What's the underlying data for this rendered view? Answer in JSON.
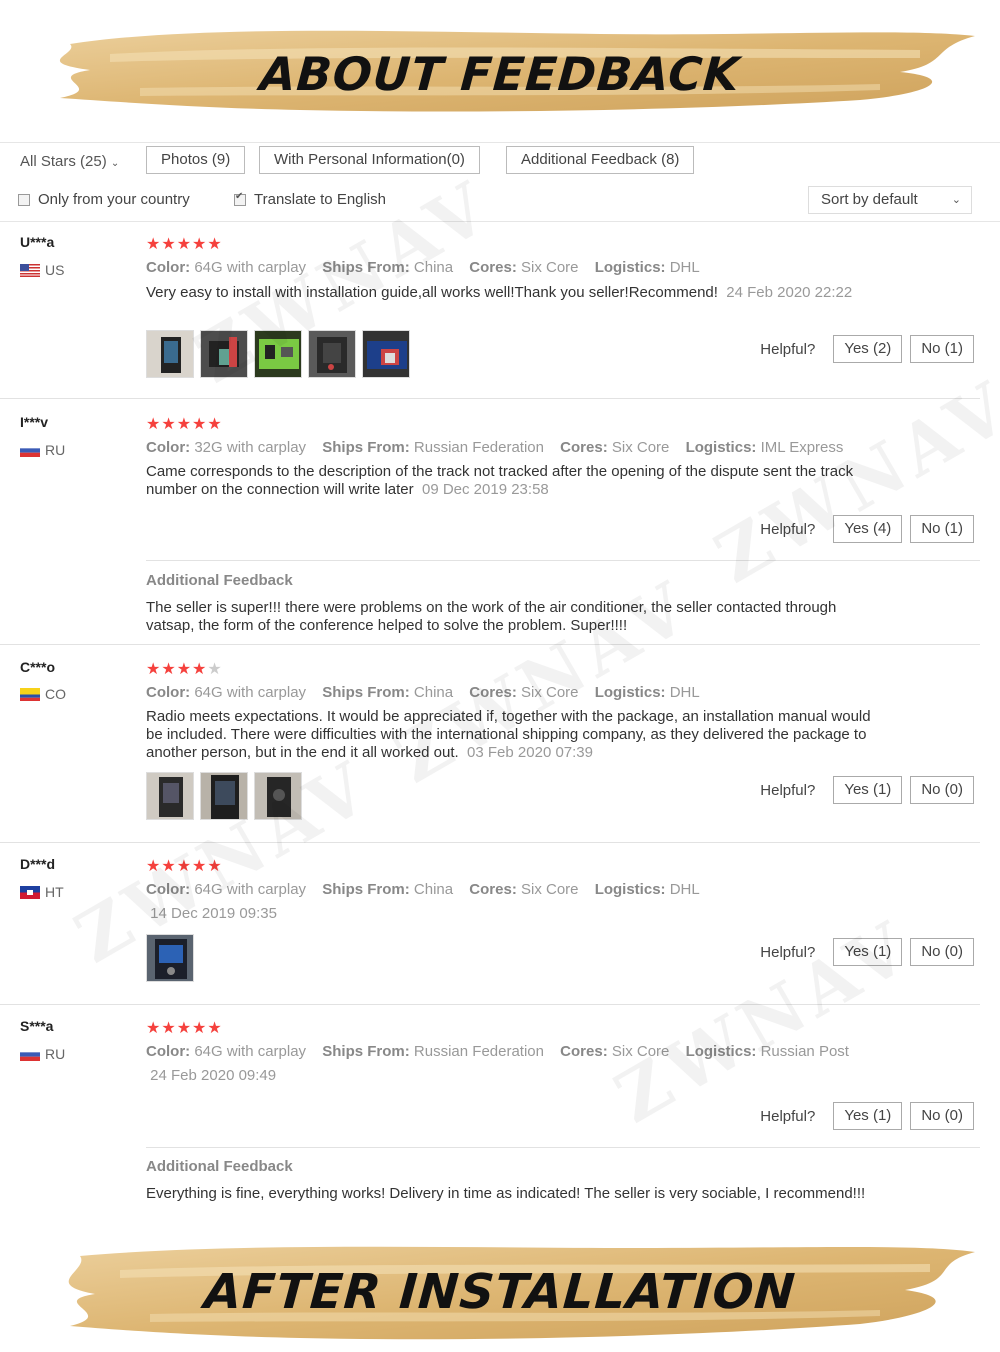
{
  "banners": {
    "top": "ABOUT FEEDBACK",
    "bottom": "AFTER INSTALLATION"
  },
  "watermark": "ZWNAV",
  "filters": {
    "all_stars": "All Stars (25)",
    "photos": "Photos (9)",
    "personal_info": "With Personal Information(0)",
    "additional": "Additional Feedback (8)",
    "only_country": "Only from your country",
    "only_country_checked": false,
    "translate": "Translate to English",
    "translate_checked": true,
    "sort": "Sort by default"
  },
  "labels": {
    "color": "Color:",
    "ships_from": "Ships From:",
    "cores": "Cores:",
    "logistics": "Logistics:",
    "helpful": "Helpful?",
    "additional_feedback": "Additional Feedback"
  },
  "reviews": [
    {
      "user": "U***a",
      "country": "US",
      "rating": 5,
      "color": "64G with carplay",
      "ships_from": "China",
      "cores": "Six Core",
      "logistics": "DHL",
      "text": "Very easy to install with installation guide,all works well!Thank you seller!Recommend!",
      "date": "24 Feb 2020 22:22",
      "photos": 5,
      "yes": "Yes (2)",
      "no": "No (1)"
    },
    {
      "user": "I***v",
      "country": "RU",
      "rating": 5,
      "color": "32G with carplay",
      "ships_from": "Russian Federation",
      "cores": "Six Core",
      "logistics": "IML Express",
      "text": "Came corresponds to the description of the track not tracked after the opening of the dispute sent the track number on the connection will write later",
      "date": "09 Dec 2019 23:58",
      "photos": 0,
      "yes": "Yes (4)",
      "no": "No (1)",
      "additional": "The seller is super!!! there were problems on the work of the air conditioner, the seller contacted through vatsap, the form of the conference helped to solve the problem. Super!!!!"
    },
    {
      "user": "C***o",
      "country": "CO",
      "rating": 4,
      "color": "64G with carplay",
      "ships_from": "China",
      "cores": "Six Core",
      "logistics": "DHL",
      "text": "Radio meets expectations. It would be appreciated if, together with the package, an installation manual would be included. There were difficulties with the international shipping company, as they delivered the package to another person, but in the end it all worked out.",
      "date": "03 Feb 2020 07:39",
      "photos": 3,
      "yes": "Yes (1)",
      "no": "No (0)"
    },
    {
      "user": "D***d",
      "country": "HT",
      "rating": 5,
      "color": "64G with carplay",
      "ships_from": "China",
      "cores": "Six Core",
      "logistics": "DHL",
      "text": "",
      "date": "14 Dec 2019 09:35",
      "photos": 1,
      "yes": "Yes (1)",
      "no": "No (0)"
    },
    {
      "user": "S***a",
      "country": "RU",
      "rating": 5,
      "color": "64G with carplay",
      "ships_from": "Russian Federation",
      "cores": "Six Core",
      "logistics": "Russian Post",
      "text": "",
      "date": "24 Feb 2020 09:49",
      "photos": 0,
      "yes": "Yes (1)",
      "no": "No (0)",
      "additional": "Everything is fine, everything works! Delivery in time as indicated! The seller is very sociable, I recommend!!!"
    }
  ]
}
